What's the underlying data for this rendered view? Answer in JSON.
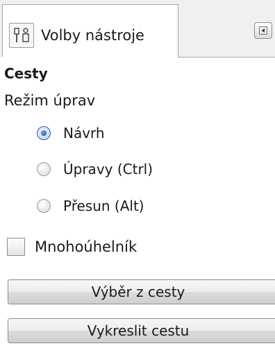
{
  "tab": {
    "label": "Volby nástroje",
    "icon": "tool-options-icon",
    "menu_icon": "tab-menu-arrow-icon"
  },
  "section": {
    "title": "Cesty"
  },
  "edit_mode": {
    "label": "Režim úprav",
    "options": [
      {
        "label": "Návrh",
        "checked": true
      },
      {
        "label": "Úpravy (Ctrl)",
        "checked": false
      },
      {
        "label": "Přesun (Alt)",
        "checked": false
      }
    ]
  },
  "polygon": {
    "label": "Mnohoúhelník",
    "checked": false
  },
  "buttons": {
    "selection_from_path": "Výběr z cesty",
    "stroke_path": "Vykreslit cestu"
  }
}
